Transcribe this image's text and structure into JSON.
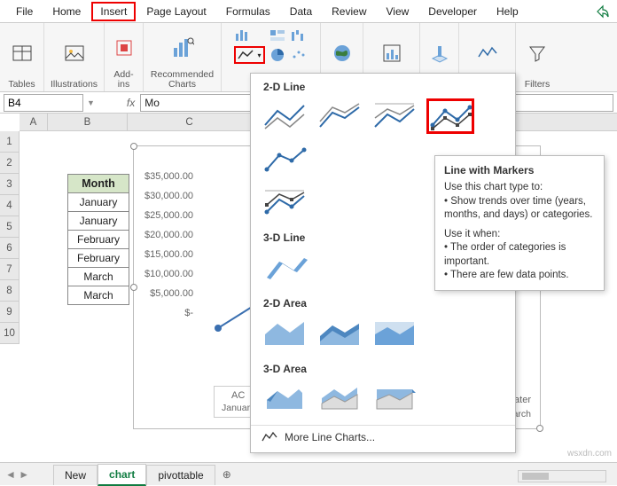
{
  "tabs": {
    "file": "File",
    "home": "Home",
    "insert": "Insert",
    "pagelayout": "Page Layout",
    "formulas": "Formulas",
    "data": "Data",
    "review": "Review",
    "view": "View",
    "developer": "Developer",
    "help": "Help"
  },
  "ribbon": {
    "tables": "Tables",
    "illustrations": "Illustrations",
    "addins": "Add-\nins",
    "reccharts": "Recommended\nCharts",
    "charts": "Charts",
    "maps": "Maps",
    "pivotchart": "PivotChart",
    "3d": "3D",
    "sparklines": "Sparklines",
    "filters": "Filters"
  },
  "namebox": "B4",
  "fx": "fx",
  "formula": "Mo",
  "cols": [
    "A",
    "B",
    "C"
  ],
  "rows": [
    "1",
    "2",
    "3",
    "4",
    "5",
    "6",
    "7",
    "8",
    "9",
    "10"
  ],
  "data_header": "Month",
  "data_rows": [
    "January",
    "January",
    "February",
    "February",
    "March",
    "March"
  ],
  "yaxis": [
    "$35,000.00",
    "$30,000.00",
    "$25,000.00",
    "$20,000.00",
    "$15,000.00",
    "$10,000.00",
    "$5,000.00",
    "$-"
  ],
  "legend_series": "AC",
  "legend_cat": "January",
  "panel": {
    "sec1": "2-D Line",
    "sec2": "3-D Line",
    "sec3": "2-D Area",
    "sec4": "3-D Area",
    "more": "More Line Charts..."
  },
  "tooltip": {
    "title": "Line with Markers",
    "l1": "Use this chart type to:",
    "l2": "• Show trends over time (years, months, and days) or categories.",
    "l3": "Use it when:",
    "l4": "• The order of categories is important.",
    "l5": "• There are few data points."
  },
  "sheets": {
    "s1": "New",
    "s2": "chart",
    "s3": "pivottable"
  },
  "right_labels": {
    "a": "ater",
    "b": "arch"
  },
  "watermark": "wsxdn.com",
  "chart_data": {
    "type": "line",
    "categories": [
      "January"
    ],
    "series": [
      {
        "name": "AC",
        "values": [
          5000
        ]
      }
    ],
    "ylim": [
      0,
      35000
    ],
    "yticks": [
      0,
      5000,
      10000,
      15000,
      20000,
      25000,
      30000,
      35000
    ],
    "title": "",
    "xlabel": "",
    "ylabel": ""
  }
}
